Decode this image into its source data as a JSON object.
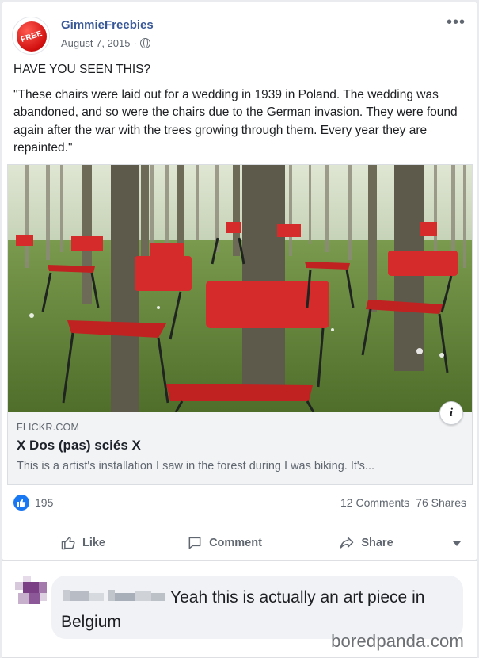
{
  "post": {
    "page_name": "GimmieFreebies",
    "avatar_text": "FREE",
    "date": "August 7, 2015",
    "separator": "·",
    "more_label": "•••",
    "headline": "HAVE YOU SEEN THIS?",
    "body": "\"These chairs were laid out for a wedding in 1939 in Poland. The wedding was abandoned, and so were the chairs due to the German invasion. They were found again after the war with the trees growing through them. Every year they are repainted.\""
  },
  "link": {
    "domain": "FLICKR.COM",
    "title": "X Dos (pas) sciés X",
    "description": "This is a artist's installation I saw in the forest during I was biking. It's...",
    "info_glyph": "i"
  },
  "stats": {
    "likes": "195",
    "comments": "12 Comments",
    "shares": "76 Shares"
  },
  "actions": {
    "like": "Like",
    "comment": "Comment",
    "share": "Share"
  },
  "comment": {
    "text": "Yeah this is actually an art piece in Belgium"
  },
  "watermark": "boredpanda.com",
  "colors": {
    "brand_blue": "#385898",
    "like_blue": "#1877f2",
    "chair_red": "#d62b2b"
  }
}
